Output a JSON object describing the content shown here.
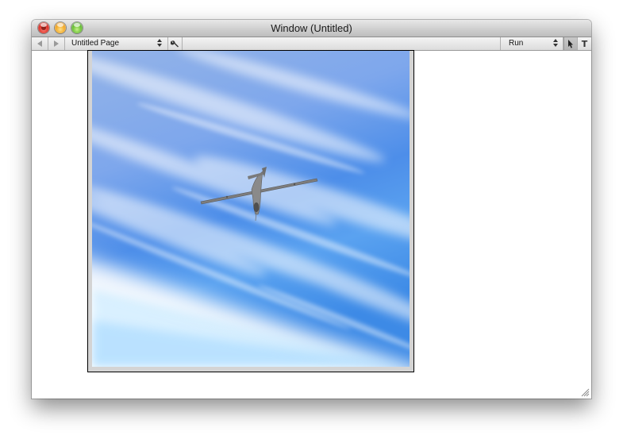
{
  "window": {
    "title": "Window (Untitled)"
  },
  "toolbar": {
    "page_selector_value": "Untitled Page",
    "run_selector_value": "Run",
    "text_tool_glyph": "T"
  },
  "icons": {
    "back": "back-arrow-icon",
    "forward": "forward-arrow-icon",
    "inspector": "wrench-icon",
    "pointer": "arrow-pointer-icon",
    "text_tool": "text-tool-icon",
    "resize": "resize-grip-icon"
  },
  "colors": {
    "sky_top": "#8fb1e6",
    "sky_mid": "#4f8fe8",
    "horizon": "#ffffff",
    "close": "#d8261c",
    "minimize": "#f0a21c",
    "zoom": "#5eb82a"
  }
}
